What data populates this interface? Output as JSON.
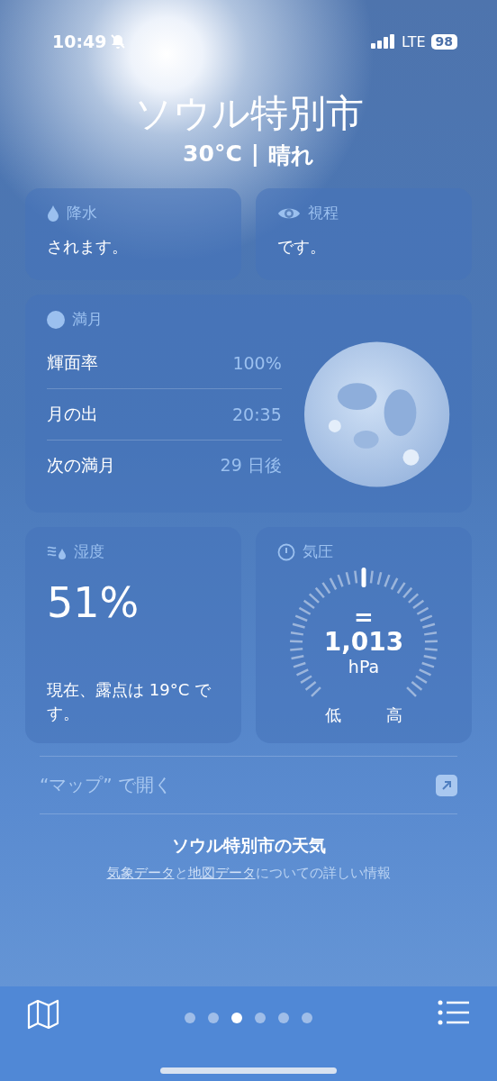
{
  "status_bar": {
    "time": "10:49",
    "silent": true,
    "network": "LTE",
    "battery": "98"
  },
  "header": {
    "city": "ソウル特別市",
    "temperature": "30°C",
    "separator": "|",
    "condition": "晴れ"
  },
  "small_cards": [
    {
      "kind": "precipitation",
      "title": "降水",
      "text": "されます。"
    },
    {
      "kind": "visibility",
      "title": "視程",
      "text": "です。"
    }
  ],
  "moon": {
    "title": "満月",
    "rows": [
      {
        "label": "輝面率",
        "value": "100%"
      },
      {
        "label": "月の出",
        "value": "20:35"
      },
      {
        "label": "次の満月",
        "value": "29 日後"
      }
    ]
  },
  "humidity": {
    "title": "湿度",
    "value": "51%",
    "text": "現在、露点は 19°C です。"
  },
  "pressure": {
    "title": "気圧",
    "trend": "=",
    "value": "1,013",
    "unit": "hPa",
    "low": "低",
    "high": "高",
    "level": 0.5
  },
  "maps_link": {
    "label": "“マップ” で開く"
  },
  "footer": {
    "title": "ソウル特別市の天気",
    "parts": [
      {
        "kind": "link",
        "text": "気象データ"
      },
      {
        "kind": "text",
        "text": "と"
      },
      {
        "kind": "link",
        "text": "地図データ"
      },
      {
        "kind": "text",
        "text": "についての詳しい情報"
      }
    ]
  },
  "page_dots": [
    {
      "selected": false
    },
    {
      "selected": false
    },
    {
      "selected": true
    },
    {
      "selected": false
    },
    {
      "selected": false
    },
    {
      "selected": false
    }
  ]
}
